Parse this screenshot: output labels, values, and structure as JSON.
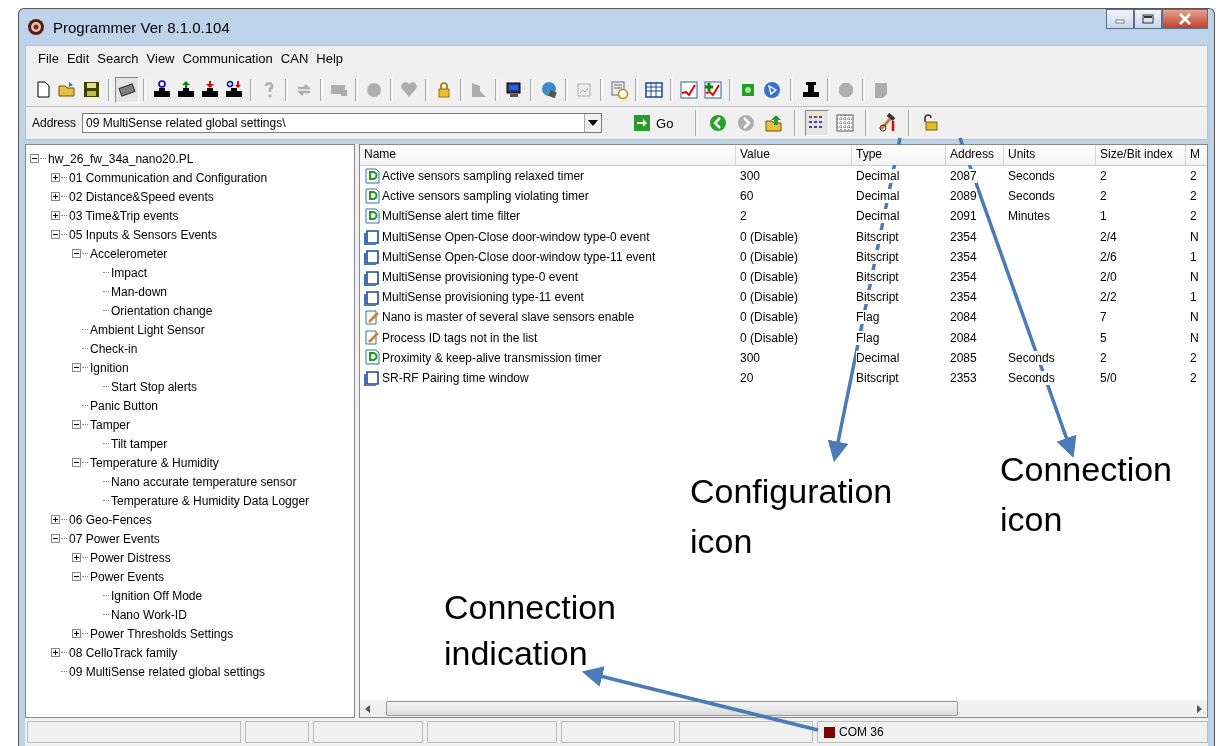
{
  "window": {
    "title": "Programmer  Ver 8.1.0.104"
  },
  "menu": [
    "File",
    "Edit",
    "Search",
    "View",
    "Communication",
    "CAN",
    "Help"
  ],
  "toolbar": [
    {
      "disabled": false,
      "pressed": false
    },
    {
      "disabled": false,
      "pressed": false
    },
    {
      "disabled": false,
      "pressed": false
    },
    {
      "disabled": false,
      "pressed": true
    },
    {
      "disabled": false,
      "pressed": false
    },
    {
      "disabled": false,
      "pressed": false
    },
    {
      "disabled": false,
      "pressed": false
    },
    {
      "disabled": false,
      "pressed": false
    },
    {
      "disabled": true,
      "pressed": false
    },
    {
      "disabled": true,
      "pressed": false
    },
    {
      "disabled": true,
      "pressed": false
    },
    {
      "disabled": true,
      "pressed": false
    },
    {
      "disabled": true,
      "pressed": false
    },
    {
      "disabled": false,
      "pressed": false
    },
    {
      "disabled": true,
      "pressed": false
    },
    {
      "disabled": false,
      "pressed": false
    },
    {
      "disabled": false,
      "pressed": false
    },
    {
      "disabled": true,
      "pressed": false
    },
    {
      "disabled": false,
      "pressed": false
    },
    {
      "disabled": false,
      "pressed": false
    },
    {
      "disabled": false,
      "pressed": false
    },
    {
      "disabled": false,
      "pressed": false
    },
    {
      "disabled": false,
      "pressed": false
    },
    {
      "disabled": false,
      "pressed": false
    },
    {
      "disabled": false,
      "pressed": false
    },
    {
      "disabled": true,
      "pressed": false
    },
    {
      "disabled": true,
      "pressed": false
    }
  ],
  "address_bar": {
    "label": "Address",
    "value": "09 MultiSense related global settings\\",
    "go_button": "Go",
    "tools": [
      {
        "disabled": false,
        "pressed": false
      },
      {
        "disabled": true,
        "pressed": false
      },
      {
        "disabled": false,
        "pressed": false
      },
      {
        "disabled": false,
        "pressed": true
      },
      {
        "disabled": false,
        "pressed": false
      },
      {
        "disabled": false,
        "pressed": false
      },
      {
        "disabled": false,
        "pressed": false
      }
    ]
  },
  "tree": [
    {
      "label": "hw_26_fw_34a_nano20.PL",
      "expanded": true,
      "children": [
        {
          "label": "01 Communication and Configuration",
          "expanded": false
        },
        {
          "label": "02 Distance&Speed events",
          "expanded": false
        },
        {
          "label": "03 Time&Trip events",
          "expanded": false
        },
        {
          "label": "05 Inputs & Sensors Events",
          "expanded": true,
          "children": [
            {
              "label": "Accelerometer",
              "expanded": true,
              "children": [
                {
                  "label": "Impact"
                },
                {
                  "label": "Man-down"
                },
                {
                  "label": "Orientation change"
                }
              ]
            },
            {
              "label": "Ambient Light Sensor"
            },
            {
              "label": "Check-in"
            },
            {
              "label": "Ignition",
              "expanded": true,
              "children": [
                {
                  "label": "Start Stop alerts"
                }
              ]
            },
            {
              "label": "Panic Button"
            },
            {
              "label": "Tamper",
              "expanded": true,
              "children": [
                {
                  "label": "Tilt tamper"
                }
              ]
            },
            {
              "label": "Temperature & Humidity",
              "expanded": true,
              "children": [
                {
                  "label": "Nano accurate temperature sensor"
                },
                {
                  "label": "Temperature & Humidity Data Logger"
                }
              ]
            }
          ]
        },
        {
          "label": "06 Geo-Fences",
          "expanded": false
        },
        {
          "label": "07 Power Events",
          "expanded": true,
          "children": [
            {
              "label": "Power Distress",
              "expanded": false
            },
            {
              "label": "Power Events",
              "expanded": true,
              "children": [
                {
                  "label": "Ignition Off Mode"
                },
                {
                  "label": "Nano Work-ID"
                }
              ]
            },
            {
              "label": "Power Thresholds Settings",
              "expanded": false
            }
          ]
        },
        {
          "label": "08 CelloTrack family",
          "expanded": false
        },
        {
          "label": "09 MultiSense related global settings"
        }
      ]
    }
  ],
  "table": {
    "columns": [
      "Name",
      "Value",
      "Type",
      "Address",
      "Units",
      "Size/Bit index",
      "M"
    ],
    "rows": [
      {
        "kind": "decimal",
        "cells": [
          "Active sensors sampling relaxed timer",
          "300",
          "Decimal",
          "2087",
          "Seconds",
          "2",
          "2"
        ]
      },
      {
        "kind": "decimal",
        "cells": [
          "Active sensors sampling violating timer",
          "60",
          "Decimal",
          "2089",
          "Seconds",
          "2",
          "2"
        ]
      },
      {
        "kind": "decimal",
        "cells": [
          "MultiSense alert time filter",
          "2",
          "Decimal",
          "2091",
          "Minutes",
          "1",
          "2"
        ]
      },
      {
        "kind": "bitscript",
        "cells": [
          "MultiSense Open-Close door-window type-0 event",
          "0 (Disable)",
          "Bitscript",
          "2354",
          "",
          "2/4",
          "N"
        ]
      },
      {
        "kind": "bitscript",
        "cells": [
          "MultiSense Open-Close door-window type-11 event",
          "0 (Disable)",
          "Bitscript",
          "2354",
          "",
          "2/6",
          "1"
        ]
      },
      {
        "kind": "bitscript",
        "cells": [
          "MultiSense provisioning type-0 event",
          "0 (Disable)",
          "Bitscript",
          "2354",
          "",
          "2/0",
          "N"
        ]
      },
      {
        "kind": "bitscript",
        "cells": [
          "MultiSense provisioning type-11 event",
          "0 (Disable)",
          "Bitscript",
          "2354",
          "",
          "2/2",
          "1"
        ]
      },
      {
        "kind": "flag",
        "cells": [
          "Nano is master of several slave sensors enable",
          "0 (Disable)",
          "Flag",
          "2084",
          "",
          "7",
          "N"
        ]
      },
      {
        "kind": "flag",
        "cells": [
          "Process ID tags not in the list",
          "0 (Disable)",
          "Flag",
          "2084",
          "",
          "5",
          "N"
        ]
      },
      {
        "kind": "decimal",
        "cells": [
          "Proximity & keep-alive transmission timer",
          "300",
          "Decimal",
          "2085",
          "Seconds",
          "2",
          "2"
        ]
      },
      {
        "kind": "bitscript",
        "cells": [
          "SR-RF Pairing time window",
          "20",
          "Bitscript",
          "2353",
          "Seconds",
          "5/0",
          "2"
        ]
      }
    ]
  },
  "status_bar": {
    "connection": {
      "text": "COM 36",
      "color": "#800000"
    }
  },
  "annotations": [
    {
      "kind": "configuration",
      "text": "Configuration icon"
    },
    {
      "kind": "connection",
      "text": "Connection icon"
    },
    {
      "kind": "indication",
      "text": "Connection indication"
    }
  ]
}
